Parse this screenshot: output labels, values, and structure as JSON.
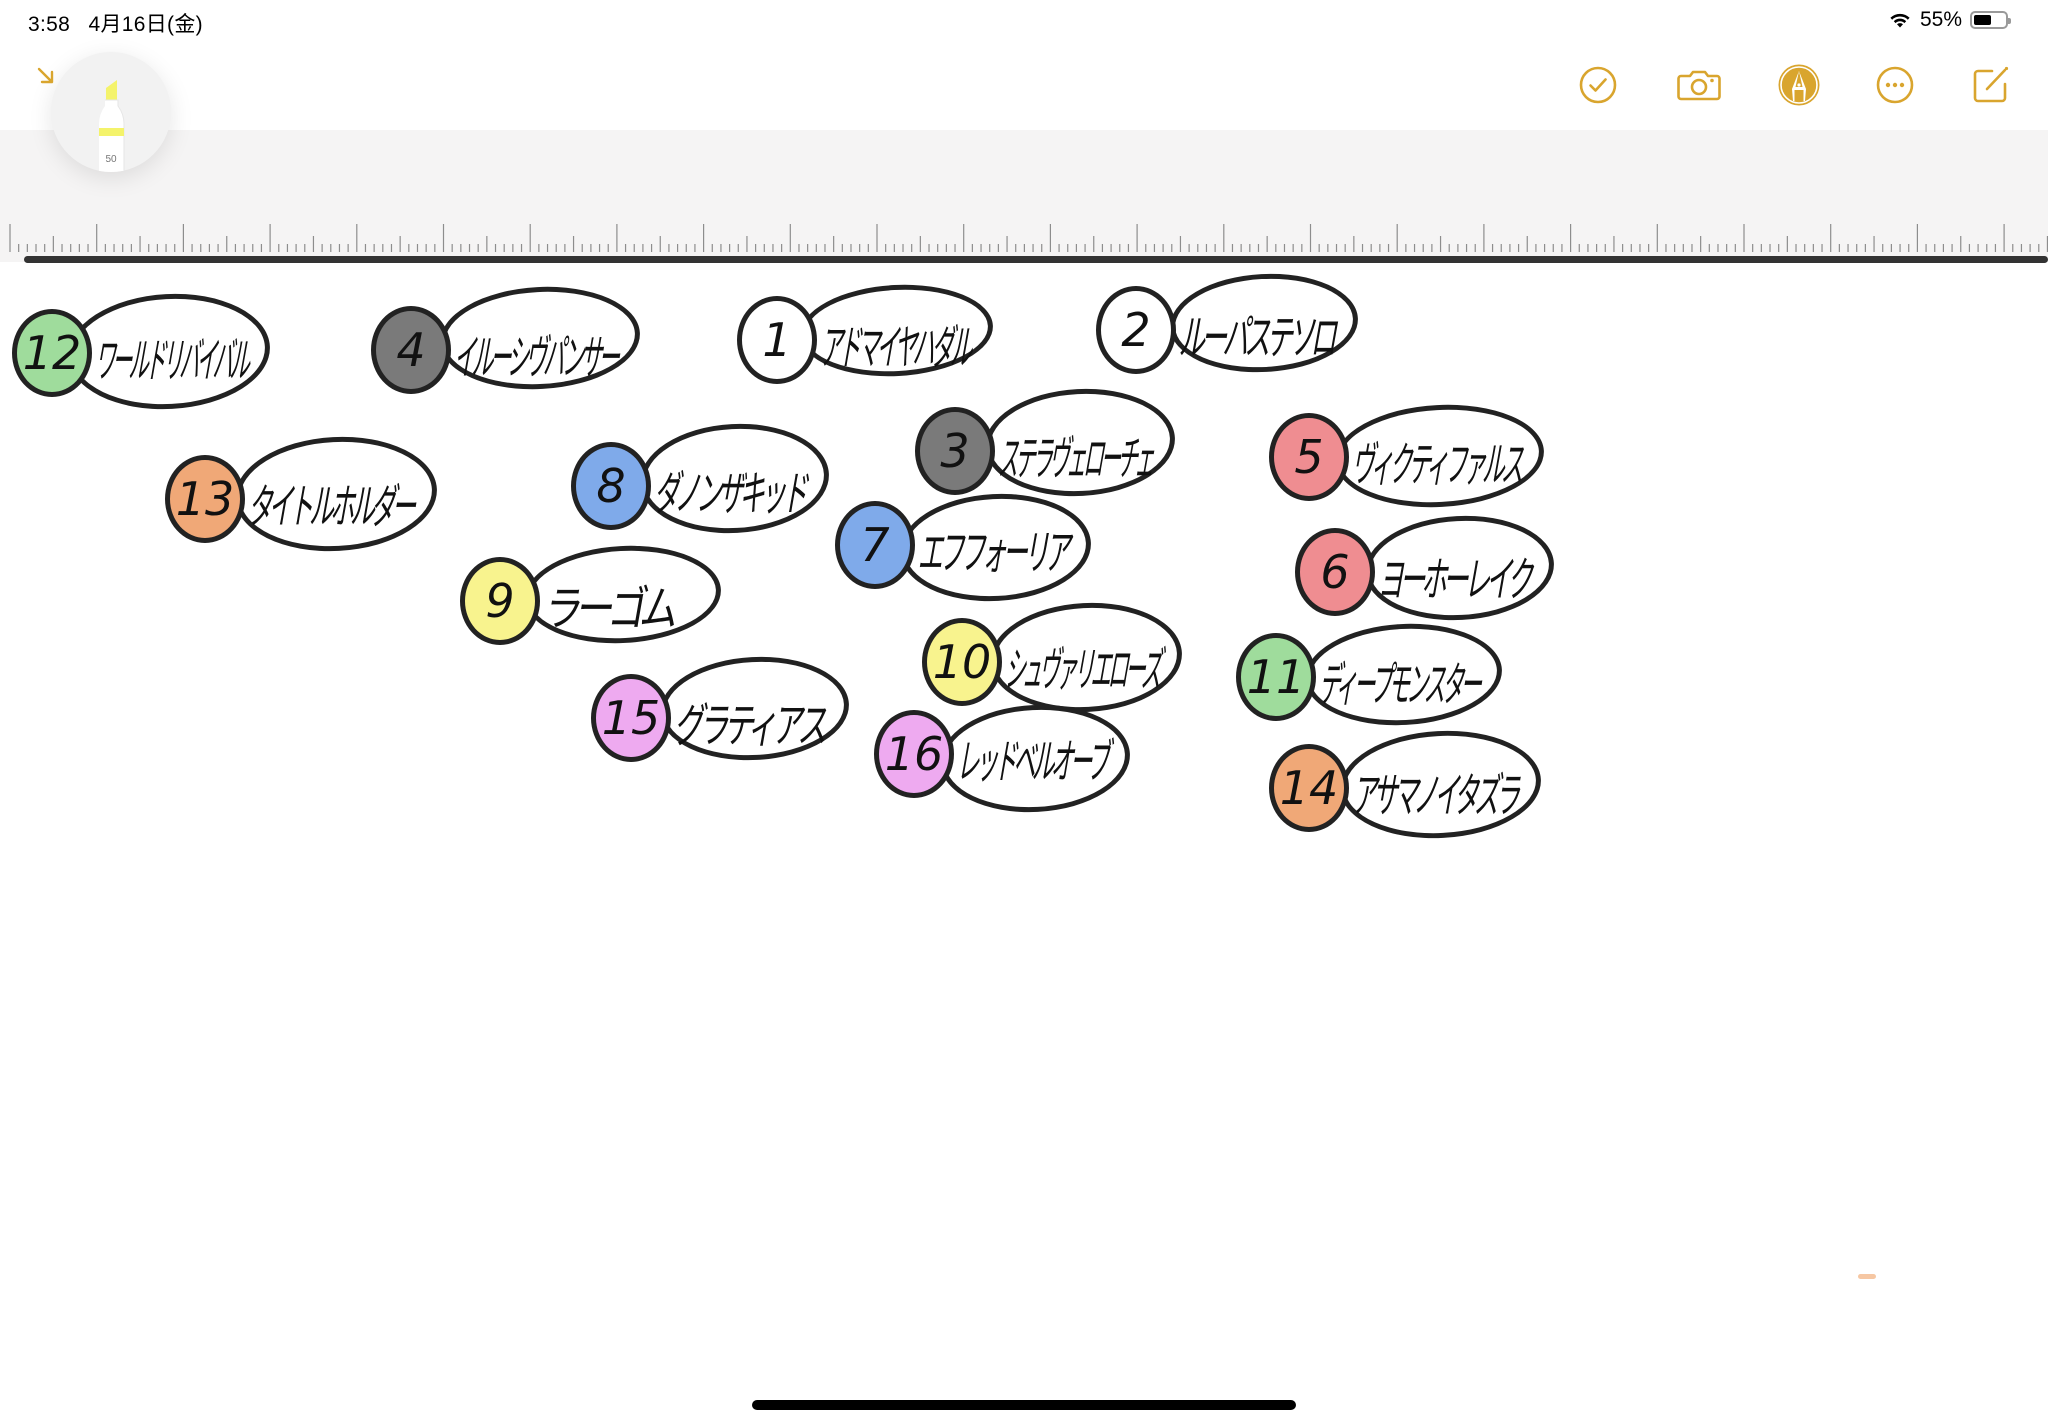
{
  "status_bar": {
    "time": "3:58",
    "date": "4月16日(金)",
    "battery_percent": "55%",
    "battery_level": 0.55,
    "wifi_icon": "wifi-icon"
  },
  "toolbar": {
    "accent_color": "#d9a52e",
    "buttons": [
      {
        "name": "checklist-button",
        "icon": "checkmark-circle-icon"
      },
      {
        "name": "camera-button",
        "icon": "camera-icon"
      },
      {
        "name": "markup-button",
        "icon": "pen-tip-circle-icon",
        "active": true
      },
      {
        "name": "more-button",
        "icon": "ellipsis-circle-icon"
      },
      {
        "name": "compose-button",
        "icon": "square-pencil-icon"
      }
    ]
  },
  "tool_palette": {
    "collapse_icon": "arrow-down-right-icon",
    "tool": "highlighter",
    "tool_color": "#f4f36b",
    "tool_size_label": "50"
  },
  "note": {
    "items": [
      {
        "number": "12",
        "name": "ワールドリバイバル",
        "color": "#9fdc9c"
      },
      {
        "number": "4",
        "name": "イルーシヴパンサー",
        "color": "#7a7a7a"
      },
      {
        "number": "1",
        "name": "アドマイヤハダル",
        "color": "#ffffff"
      },
      {
        "number": "2",
        "name": "ルーパステソロ",
        "color": "#ffffff"
      },
      {
        "number": "13",
        "name": "タイトルホルダー",
        "color": "#f0a877"
      },
      {
        "number": "8",
        "name": "ダノンザキッド",
        "color": "#7faaea"
      },
      {
        "number": "3",
        "name": "ステラヴェローチェ",
        "color": "#7a7a7a"
      },
      {
        "number": "5",
        "name": "ヴィクティファルス",
        "color": "#ef8d91"
      },
      {
        "number": "7",
        "name": "エフフォーリア",
        "color": "#7faaea"
      },
      {
        "number": "6",
        "name": "ヨーホーレイク",
        "color": "#ef8d91"
      },
      {
        "number": "9",
        "name": "ラーゴム",
        "color": "#f8f38e"
      },
      {
        "number": "10",
        "name": "シュヴァリエローズ",
        "color": "#f8f38e"
      },
      {
        "number": "11",
        "name": "ディープモンスター",
        "color": "#9fdc9c"
      },
      {
        "number": "15",
        "name": "グラティアス",
        "color": "#eeaaf0"
      },
      {
        "number": "16",
        "name": "レッドベルオーブ",
        "color": "#eeaaf0"
      },
      {
        "number": "14",
        "name": "アサマノイタズラ",
        "color": "#f0a877"
      }
    ]
  }
}
